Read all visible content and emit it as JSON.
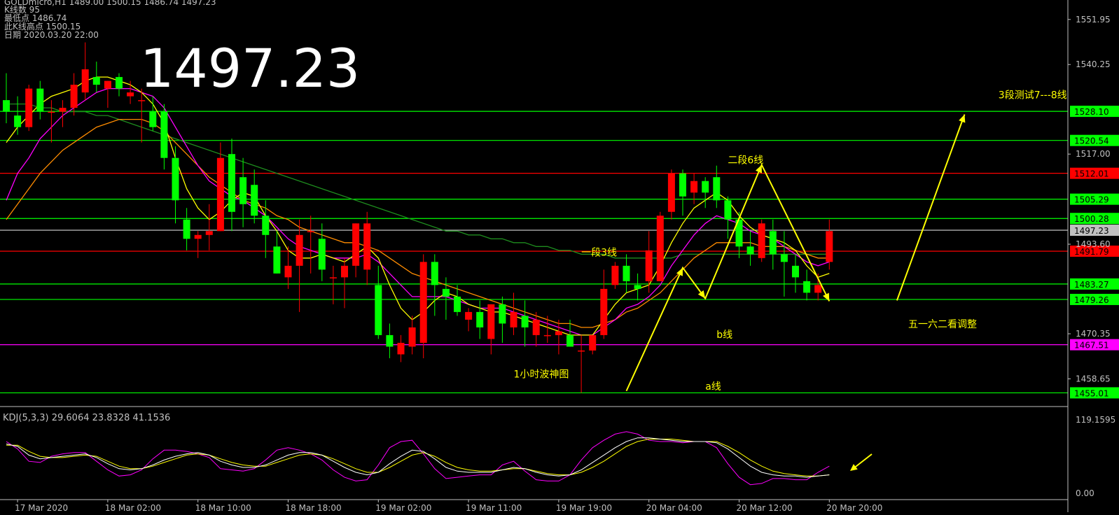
{
  "chart_data": {
    "type": "candlestick",
    "symbol_header": "GOLDmicro,H1  1489.00 1500.15 1486.74 1497.23",
    "info_lines": [
      "K线数  95",
      "最低点  1486.74",
      "此K线高点  1500.15",
      "日期  2020.03.20 22:00"
    ],
    "big_price": "1497.23",
    "ylim": [
      1452,
      1557
    ],
    "price_ticks": [
      "1551.95",
      "1540.25",
      "1517.00",
      "1493.60",
      "1470.35",
      "1458.65"
    ],
    "tick_values": [
      1551.95,
      1540.25,
      1517.0,
      1493.6,
      1470.35,
      1458.65
    ],
    "levels": [
      {
        "value": 1528.1,
        "label": "1528.10",
        "color": "#00ff00"
      },
      {
        "value": 1520.54,
        "label": "1520.54",
        "color": "#00ff00"
      },
      {
        "value": 1512.01,
        "label": "1512.01",
        "color": "#ff0000"
      },
      {
        "value": 1505.29,
        "label": "1505.29",
        "color": "#00ff00"
      },
      {
        "value": 1500.28,
        "label": "1500.28",
        "color": "#00ff00"
      },
      {
        "value": 1497.23,
        "label": "1497.23",
        "color": "#c0c0c0"
      },
      {
        "value": 1491.79,
        "label": "1491.79",
        "color": "#ff0000"
      },
      {
        "value": 1483.27,
        "label": "1483.27",
        "color": "#00ff00"
      },
      {
        "value": 1479.26,
        "label": "1479.26",
        "color": "#00ff00"
      },
      {
        "value": 1467.51,
        "label": "1467.51",
        "color": "#ff00ff"
      },
      {
        "value": 1455.01,
        "label": "1455.01",
        "color": "#00ff00"
      }
    ],
    "annotations": [
      {
        "text": "3段测试7---8线",
        "price": 1531.5,
        "bar": 88
      },
      {
        "text": "二段6线",
        "price": 1514.6,
        "bar": 64
      },
      {
        "text": "一段3线",
        "price": 1490.6,
        "bar": 51
      },
      {
        "text": "b线",
        "price": 1469.3,
        "bar": 63
      },
      {
        "text": "五一六二看调整",
        "price": 1472.0,
        "bar": 80
      },
      {
        "text": "1小时波神图",
        "price": 1459.0,
        "bar": 45
      },
      {
        "text": "a线",
        "price": 1455.8,
        "bar": 62
      }
    ],
    "waves": [
      [
        [
          55,
          1455.5
        ],
        [
          60,
          1487.5
        ],
        [
          62,
          1479.5
        ],
        [
          67,
          1514.2
        ],
        [
          73,
          1478.8
        ]
      ],
      [
        [
          79,
          1479.0
        ],
        [
          85,
          1527.3
        ]
      ]
    ],
    "time_labels": [
      {
        "text": "17 Mar 2020",
        "bar": 1
      },
      {
        "text": "18 Mar 02:00",
        "bar": 9
      },
      {
        "text": "18 Mar 10:00",
        "bar": 17
      },
      {
        "text": "18 Mar 18:00",
        "bar": 25
      },
      {
        "text": "19 Mar 02:00",
        "bar": 33
      },
      {
        "text": "19 Mar 11:00",
        "bar": 41
      },
      {
        "text": "19 Mar 19:00",
        "bar": 49
      },
      {
        "text": "20 Mar 04:00",
        "bar": 57
      },
      {
        "text": "20 Mar 12:00",
        "bar": 65
      },
      {
        "text": "20 Mar 20:00",
        "bar": 73
      }
    ],
    "candles": [
      [
        1531,
        1538,
        1525,
        1528
      ],
      [
        1527,
        1532,
        1522,
        1524
      ],
      [
        1524,
        1535,
        1523,
        1534
      ],
      [
        1534,
        1536,
        1526,
        1528
      ],
      [
        1528,
        1531,
        1520,
        1528
      ],
      [
        1528,
        1531,
        1524,
        1529
      ],
      [
        1529,
        1538,
        1527,
        1535
      ],
      [
        1533,
        1546,
        1531,
        1539
      ],
      [
        1537,
        1541,
        1533,
        1535
      ],
      [
        1534,
        1536,
        1529,
        1536
      ],
      [
        1537,
        1538,
        1532,
        1534
      ],
      [
        1532,
        1536,
        1530,
        1533
      ],
      [
        1531,
        1534,
        1520,
        1531
      ],
      [
        1528,
        1532,
        1523,
        1524
      ],
      [
        1528,
        1530,
        1513,
        1516
      ],
      [
        1516,
        1519,
        1499,
        1505
      ],
      [
        1500,
        1503,
        1492,
        1495
      ],
      [
        1495,
        1497,
        1490,
        1496
      ],
      [
        1496,
        1504,
        1492,
        1497
      ],
      [
        1497,
        1520,
        1497,
        1516
      ],
      [
        1517,
        1521,
        1497,
        1502
      ],
      [
        1511,
        1516,
        1498,
        1504
      ],
      [
        1509,
        1513,
        1499,
        1501
      ],
      [
        1501,
        1505,
        1490,
        1496
      ],
      [
        1493,
        1497,
        1486,
        1486
      ],
      [
        1485,
        1493,
        1482,
        1488
      ],
      [
        1488,
        1500,
        1476,
        1496
      ],
      [
        1497,
        1501,
        1486,
        1497
      ],
      [
        1495,
        1499,
        1484,
        1487
      ],
      [
        1485,
        1488,
        1478,
        1485
      ],
      [
        1485,
        1490,
        1477,
        1488
      ],
      [
        1488,
        1499,
        1485,
        1499
      ],
      [
        1487,
        1502,
        1483,
        1499
      ],
      [
        1483,
        1488,
        1469,
        1470
      ],
      [
        1470,
        1473,
        1464,
        1467
      ],
      [
        1465,
        1470,
        1463,
        1468
      ],
      [
        1467,
        1475,
        1465,
        1472
      ],
      [
        1468,
        1491,
        1464,
        1489
      ],
      [
        1489,
        1491,
        1475,
        1483
      ],
      [
        1482,
        1485,
        1474,
        1480
      ],
      [
        1480,
        1483,
        1475,
        1476
      ],
      [
        1474,
        1477,
        1471,
        1476
      ],
      [
        1476,
        1479,
        1469,
        1472
      ],
      [
        1469,
        1478,
        1465,
        1478
      ],
      [
        1478,
        1480,
        1468,
        1473
      ],
      [
        1472,
        1481,
        1470,
        1476
      ],
      [
        1475,
        1479,
        1467,
        1472
      ],
      [
        1470,
        1476,
        1467,
        1474
      ],
      [
        1470,
        1475,
        1468,
        1470
      ],
      [
        1470,
        1474,
        1465,
        1471
      ],
      [
        1470,
        1474,
        1467,
        1467
      ],
      [
        1466,
        1470,
        1455,
        1466
      ],
      [
        1466,
        1470,
        1465,
        1470
      ],
      [
        1470,
        1487,
        1469,
        1482
      ],
      [
        1483,
        1489,
        1482,
        1488
      ],
      [
        1488,
        1491,
        1481,
        1484
      ],
      [
        1483,
        1486,
        1479,
        1482
      ],
      [
        1484,
        1497,
        1481,
        1492
      ],
      [
        1484,
        1502,
        1484,
        1501
      ],
      [
        1502,
        1513,
        1500,
        1512
      ],
      [
        1512,
        1513,
        1501,
        1506
      ],
      [
        1507,
        1512,
        1504,
        1510
      ],
      [
        1510,
        1511,
        1503,
        1507
      ],
      [
        1511,
        1514,
        1503,
        1505
      ],
      [
        1505,
        1506,
        1495,
        1500
      ],
      [
        1500,
        1502,
        1490,
        1493
      ],
      [
        1493,
        1497,
        1488,
        1491
      ],
      [
        1490,
        1500,
        1489,
        1499
      ],
      [
        1497,
        1500,
        1487,
        1491
      ],
      [
        1491,
        1497,
        1480,
        1489
      ],
      [
        1488,
        1491,
        1481,
        1485
      ],
      [
        1484,
        1487,
        1479,
        1481
      ],
      [
        1481,
        1486,
        1479,
        1483
      ],
      [
        1489,
        1500,
        1487,
        1497
      ]
    ],
    "ma_series": [
      {
        "name": "",
        "color": "#ffff00",
        "values": [
          1520,
          1524,
          1527,
          1530,
          1532,
          1533,
          1534,
          1536,
          1537,
          1537,
          1536,
          1535,
          1533,
          1530,
          1525,
          1516,
          1508,
          1503,
          1500,
          1502,
          1505,
          1507,
          1506,
          1501,
          1497,
          1492,
          1490,
          1490,
          1491,
          1490,
          1489,
          1491,
          1493,
          1490,
          1483,
          1477,
          1474,
          1476,
          1479,
          1481,
          1480,
          1478,
          1477,
          1476,
          1476,
          1475,
          1474,
          1473,
          1472,
          1471,
          1470,
          1470,
          1470,
          1474,
          1478,
          1481,
          1482,
          1483,
          1488,
          1494,
          1499,
          1503,
          1505,
          1507,
          1505,
          1501,
          1498,
          1496,
          1495,
          1494,
          1492,
          1488,
          1485,
          1486
        ]
      },
      {
        "name": "",
        "color": "#ff00ff",
        "values": [
          1505,
          1512,
          1516,
          1521,
          1524,
          1527,
          1529,
          1531,
          1533,
          1534,
          1534,
          1534,
          1533,
          1532,
          1529,
          1524,
          1519,
          1514,
          1510,
          1508,
          1506,
          1505,
          1503,
          1501,
          1498,
          1495,
          1493,
          1492,
          1491,
          1490,
          1490,
          1490,
          1491,
          1489,
          1486,
          1483,
          1480,
          1480,
          1480,
          1480,
          1479,
          1478,
          1477,
          1477,
          1477,
          1476,
          1475,
          1474,
          1473,
          1472,
          1471,
          1470,
          1470,
          1472,
          1474,
          1477,
          1478,
          1480,
          1483,
          1488,
          1492,
          1496,
          1499,
          1501,
          1500,
          1499,
          1497,
          1496,
          1495,
          1493,
          1491,
          1489,
          1488,
          1489
        ]
      },
      {
        "name": "",
        "color": "#ff8c00",
        "values": [
          1500,
          1504,
          1508,
          1512,
          1515,
          1518,
          1520,
          1522,
          1524,
          1525,
          1526,
          1526,
          1526,
          1525,
          1523,
          1520,
          1517,
          1514,
          1511,
          1509,
          1507,
          1505,
          1504,
          1503,
          1501,
          1500,
          1498,
          1497,
          1496,
          1495,
          1494,
          1494,
          1493,
          1492,
          1490,
          1488,
          1486,
          1485,
          1484,
          1483,
          1482,
          1481,
          1480,
          1479,
          1478,
          1477,
          1476,
          1475,
          1474,
          1473,
          1473,
          1472,
          1472,
          1473,
          1474,
          1476,
          1477,
          1479,
          1481,
          1484,
          1487,
          1490,
          1492,
          1494,
          1494,
          1494,
          1494,
          1493,
          1493,
          1493,
          1492,
          1491,
          1490,
          1490
        ]
      },
      {
        "name": "",
        "color": "#1e8c1e",
        "values": [
          1530,
          1530,
          1530,
          1529,
          1529,
          1528,
          1528,
          1528,
          1527,
          1527,
          1526,
          1525,
          1524,
          1523,
          1522,
          1521,
          1520,
          1519,
          1518,
          1517,
          1516,
          1515,
          1514,
          1513,
          1512,
          1511,
          1510,
          1509,
          1508,
          1507,
          1506,
          1505,
          1504,
          1503,
          1502,
          1501,
          1500,
          1499,
          1498,
          1497,
          1497,
          1496,
          1496,
          1495,
          1495,
          1494,
          1494,
          1493,
          1493,
          1492,
          1492,
          1491,
          1491,
          1491,
          1490,
          1490,
          1490,
          1490,
          1490,
          1490,
          1491,
          1491,
          1491,
          1491,
          1491,
          1491,
          1491,
          1491,
          1491,
          1491,
          1491,
          1491,
          1491,
          1491
        ]
      }
    ],
    "kdj": {
      "label": "KDJ(5,3,3) 29.6064 23.8328 41.1536",
      "ylim": [
        0,
        119.1595
      ],
      "ticks": [
        "119.1595",
        "0.00"
      ],
      "tick_values": [
        119.1595,
        0.0
      ],
      "series": [
        {
          "name": "",
          "color": "#ffffff",
          "values": [
            80,
            76,
            62,
            56,
            58,
            60,
            62,
            64,
            58,
            48,
            40,
            38,
            40,
            46,
            54,
            60,
            64,
            66,
            62,
            52,
            46,
            42,
            42,
            46,
            54,
            62,
            66,
            66,
            62,
            52,
            42,
            34,
            30,
            34,
            48,
            60,
            70,
            68,
            56,
            42,
            36,
            34,
            34,
            34,
            38,
            42,
            40,
            34,
            30,
            28,
            30,
            38,
            50,
            62,
            74,
            84,
            90,
            90,
            88,
            86,
            84,
            84,
            84,
            82,
            72,
            58,
            44,
            34,
            30,
            28,
            28,
            26,
            28,
            30
          ]
        },
        {
          "name": "",
          "color": "#ffff00",
          "values": [
            78,
            78,
            68,
            60,
            58,
            58,
            60,
            62,
            60,
            52,
            44,
            40,
            40,
            44,
            50,
            56,
            62,
            64,
            62,
            56,
            50,
            46,
            44,
            44,
            50,
            56,
            62,
            64,
            62,
            56,
            48,
            40,
            34,
            34,
            42,
            52,
            62,
            66,
            60,
            50,
            42,
            38,
            36,
            36,
            38,
            40,
            40,
            36,
            32,
            30,
            30,
            34,
            42,
            52,
            64,
            76,
            84,
            88,
            88,
            88,
            86,
            84,
            84,
            84,
            76,
            66,
            54,
            44,
            36,
            32,
            30,
            28,
            28,
            30
          ]
        },
        {
          "name": "",
          "color": "#ff00ff",
          "values": [
            84,
            72,
            52,
            50,
            60,
            64,
            66,
            66,
            52,
            38,
            28,
            30,
            38,
            56,
            70,
            70,
            68,
            64,
            58,
            40,
            38,
            36,
            40,
            54,
            70,
            74,
            70,
            64,
            54,
            38,
            26,
            20,
            22,
            46,
            74,
            84,
            86,
            64,
            40,
            24,
            26,
            28,
            30,
            30,
            46,
            52,
            36,
            22,
            20,
            20,
            30,
            54,
            74,
            86,
            96,
            100,
            96,
            86,
            84,
            84,
            82,
            84,
            84,
            74,
            48,
            26,
            14,
            16,
            24,
            24,
            22,
            22,
            34,
            44
          ]
        }
      ]
    }
  }
}
